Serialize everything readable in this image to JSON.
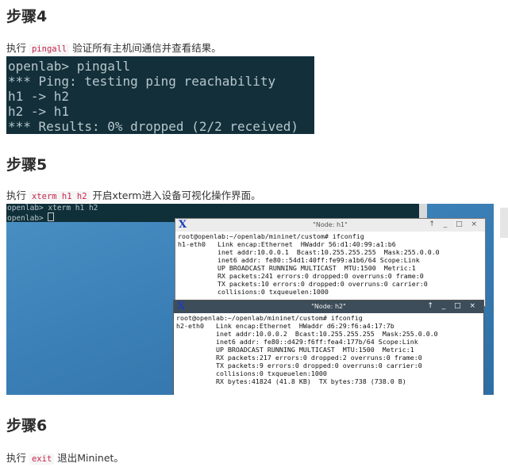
{
  "step4": {
    "title": "步骤4",
    "text_before": "执行 ",
    "code": "pingall",
    "text_after": " 验证所有主机间通信并查看结果。"
  },
  "terminal1": {
    "lines": [
      "openlab> pingall",
      "*** Ping: testing ping reachability",
      "h1 -> h2",
      "h2 -> h1",
      "*** Results: 0% dropped (2/2 received)"
    ]
  },
  "step5": {
    "title": "步骤5",
    "text_before": "执行 ",
    "code": "xterm h1 h2",
    "text_after": " 开启xterm进入设备可视化操作界面。"
  },
  "desktop": {
    "bg_terminal": {
      "line1": "openlab> xterm h1 h2",
      "line2": "openlab> "
    },
    "xterm_h1": {
      "title": "\"Node: h1\"",
      "controls": "↑ _ □ ×",
      "content": "root@openlab:~/openlab/mininet/custom# ifconfig\nh1-eth0   Link encap:Ethernet  HWaddr 56:d1:40:99:a1:b6\n          inet addr:10.0.0.1  Bcast:10.255.255.255  Mask:255.0.0.0\n          inet6 addr: fe80::54d1:40ff:fe99:a1b6/64 Scope:Link\n          UP BROADCAST RUNNING MULTICAST  MTU:1500  Metric:1\n          RX packets:241 errors:0 dropped:0 overruns:0 frame:0\n          TX packets:10 errors:0 dropped:0 overruns:0 carrier:0\n          collisions:0 txqueuelen:1000"
    },
    "xterm_h2": {
      "title": "\"Node: h2\"",
      "controls": "↑ _ □ ×",
      "content": "root@openlab:~/openlab/mininet/custom# ifconfig\nh2-eth0   Link encap:Ethernet  HWaddr d6:29:f6:a4:17:7b\n          inet addr:10.0.0.2  Bcast:10.255.255.255  Mask:255.0.0.0\n          inet6 addr: fe80::d429:f6ff:fea4:177b/64 Scope:Link\n          UP BROADCAST RUNNING MULTICAST  MTU:1500  Metric:1\n          RX packets:217 errors:0 dropped:2 overruns:0 frame:0\n          TX packets:9 errors:0 dropped:0 overruns:0 carrier:0\n          collisions:0 txqueuelen:1000\n          RX bytes:41824 (41.8 KB)  TX bytes:738 (738.0 B)"
    }
  },
  "step6": {
    "title": "步骤6",
    "text_before": "执行 ",
    "code": "exit",
    "text_after": " 退出Mininet。"
  }
}
